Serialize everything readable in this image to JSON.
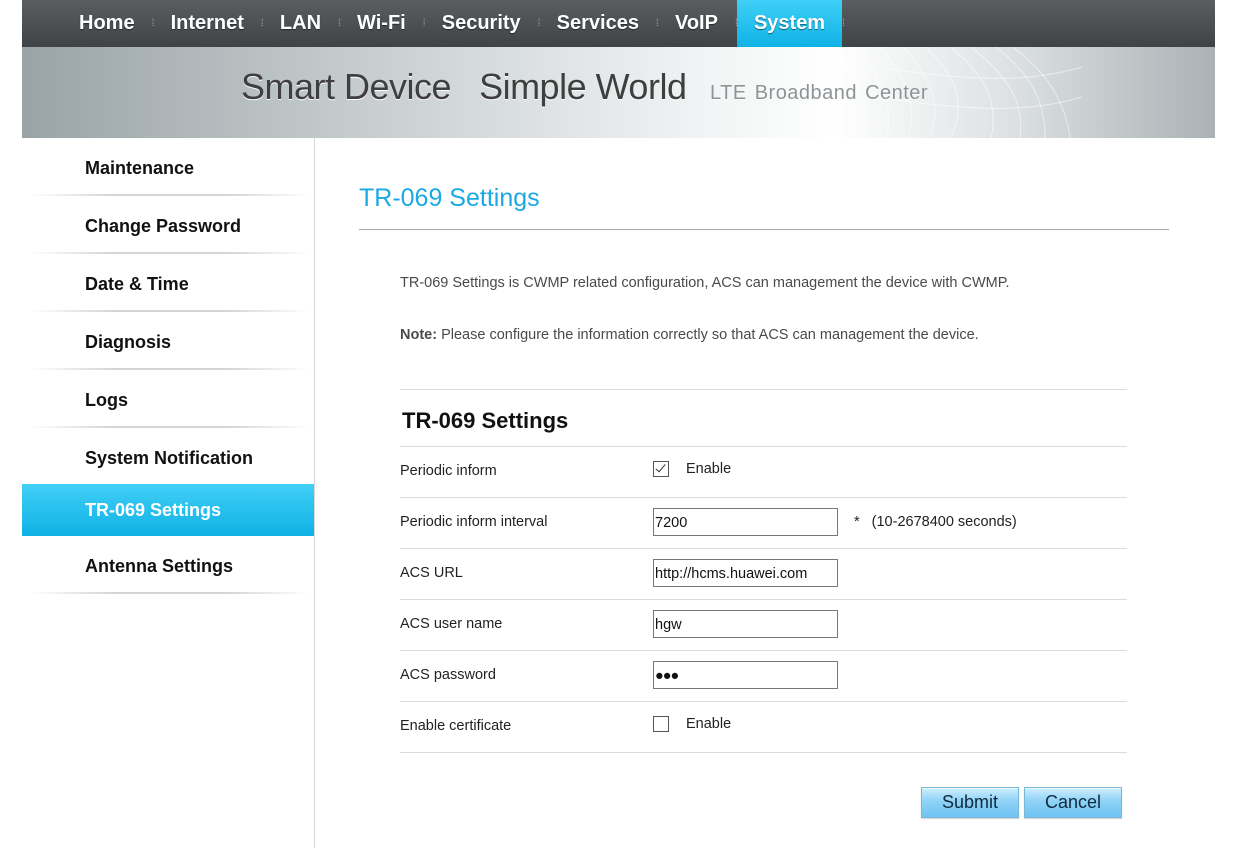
{
  "nav": {
    "items": [
      {
        "label": "Home",
        "active": false
      },
      {
        "label": "Internet",
        "active": false
      },
      {
        "label": "LAN",
        "active": false
      },
      {
        "label": "Wi-Fi",
        "active": false
      },
      {
        "label": "Security",
        "active": false
      },
      {
        "label": "Services",
        "active": false
      },
      {
        "label": "VoIP",
        "active": false
      },
      {
        "label": "System",
        "active": true
      }
    ],
    "separator": "⁞"
  },
  "banner": {
    "slogan_part1": "Smart Device",
    "slogan_part2": "Simple World",
    "sub_words": [
      "LTE",
      "Broadband",
      "Center"
    ]
  },
  "sidebar": {
    "items": [
      {
        "label": "Maintenance",
        "active": false
      },
      {
        "label": "Change Password",
        "active": false
      },
      {
        "label": "Date & Time",
        "active": false
      },
      {
        "label": "Diagnosis",
        "active": false
      },
      {
        "label": "Logs",
        "active": false
      },
      {
        "label": "System Notification",
        "active": false
      },
      {
        "label": "TR-069 Settings",
        "active": true
      },
      {
        "label": "Antenna Settings",
        "active": false
      }
    ]
  },
  "main": {
    "page_title": "TR-069 Settings",
    "description": "TR-069 Settings is CWMP related configuration, ACS can management the device with CWMP.",
    "note_label": "Note:",
    "note_text": " Please configure the information correctly so that ACS can management the device.",
    "section_title": "TR-069 Settings",
    "fields": {
      "periodic_inform": {
        "label": "Periodic inform",
        "checked": true,
        "option_label": "Enable"
      },
      "periodic_interval": {
        "label": "Periodic inform interval",
        "value": "7200",
        "required_mark": "*",
        "hint": "(10-2678400 seconds)"
      },
      "acs_url": {
        "label": "ACS URL",
        "value": "http://hcms.huawei.com"
      },
      "acs_user": {
        "label": "ACS user name",
        "value": "hgw"
      },
      "acs_password": {
        "label": "ACS password",
        "value": "●●●"
      },
      "enable_certificate": {
        "label": "Enable certificate",
        "checked": false,
        "option_label": "Enable"
      }
    },
    "submit_label": "Submit",
    "cancel_label": "Cancel"
  },
  "colors": {
    "accent": "#1aa9e3",
    "nav_bg": "#3f4345",
    "active_tab": "#10b2e6"
  }
}
